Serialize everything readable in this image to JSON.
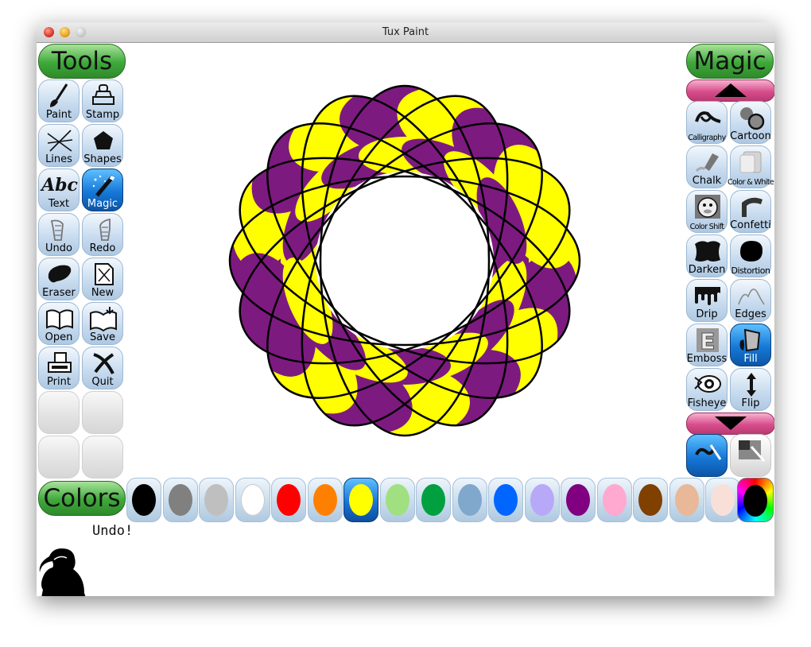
{
  "window": {
    "title": "Tux Paint"
  },
  "tools": {
    "header": "Tools",
    "items": [
      {
        "label": "Paint",
        "icon": "paintbrush-icon",
        "selected": false
      },
      {
        "label": "Stamp",
        "icon": "stamp-icon",
        "selected": false
      },
      {
        "label": "Lines",
        "icon": "lines-icon",
        "selected": false
      },
      {
        "label": "Shapes",
        "icon": "pentagon-icon",
        "selected": false
      },
      {
        "label": "Text",
        "icon": "text-abc-icon",
        "selected": false
      },
      {
        "label": "Magic",
        "icon": "magic-wand-icon",
        "selected": true
      },
      {
        "label": "Undo",
        "icon": "undo-hand-icon",
        "selected": false
      },
      {
        "label": "Redo",
        "icon": "redo-hand-icon",
        "selected": false
      },
      {
        "label": "Eraser",
        "icon": "eraser-icon",
        "selected": false
      },
      {
        "label": "New",
        "icon": "new-page-icon",
        "selected": false
      },
      {
        "label": "Open",
        "icon": "open-book-icon",
        "selected": false
      },
      {
        "label": "Save",
        "icon": "save-book-icon",
        "selected": false
      },
      {
        "label": "Print",
        "icon": "printer-icon",
        "selected": false
      },
      {
        "label": "Quit",
        "icon": "quit-x-icon",
        "selected": false
      }
    ]
  },
  "magic": {
    "header": "Magic",
    "items": [
      {
        "label": "Calligraphy",
        "icon": "calligraphy-icon",
        "selected": false
      },
      {
        "label": "Cartoon",
        "icon": "cartoon-icon",
        "selected": false
      },
      {
        "label": "Chalk",
        "icon": "chalk-icon",
        "selected": false
      },
      {
        "label": "Color & White",
        "icon": "color-white-icon",
        "selected": false
      },
      {
        "label": "Color Shift",
        "icon": "color-shift-icon",
        "selected": false
      },
      {
        "label": "Confetti",
        "icon": "confetti-icon",
        "selected": false
      },
      {
        "label": "Darken",
        "icon": "darken-icon",
        "selected": false
      },
      {
        "label": "Distortion",
        "icon": "distortion-icon",
        "selected": false
      },
      {
        "label": "Drip",
        "icon": "drip-icon",
        "selected": false
      },
      {
        "label": "Edges",
        "icon": "edges-icon",
        "selected": false
      },
      {
        "label": "Emboss",
        "icon": "emboss-icon",
        "selected": false
      },
      {
        "label": "Fill",
        "icon": "fill-bucket-icon",
        "selected": true
      },
      {
        "label": "Fisheye",
        "icon": "fisheye-icon",
        "selected": false
      },
      {
        "label": "Flip",
        "icon": "flip-icon",
        "selected": false
      }
    ],
    "modes": [
      {
        "icon": "paint-mode-icon",
        "selected": true
      },
      {
        "icon": "fullscreen-mode-icon",
        "selected": false
      }
    ]
  },
  "colors": {
    "header": "Colors",
    "palette": [
      {
        "color": "#000000",
        "selected": false
      },
      {
        "color": "#808080",
        "selected": false
      },
      {
        "color": "#bfbfbf",
        "selected": false
      },
      {
        "color": "#ffffff",
        "selected": false
      },
      {
        "color": "#ff0000",
        "selected": false
      },
      {
        "color": "#ff8000",
        "selected": false
      },
      {
        "color": "#ffff00",
        "selected": true
      },
      {
        "color": "#a0e080",
        "selected": false
      },
      {
        "color": "#00a040",
        "selected": false
      },
      {
        "color": "#80a8cc",
        "selected": false
      },
      {
        "color": "#0066ff",
        "selected": false
      },
      {
        "color": "#b8a8f8",
        "selected": false
      },
      {
        "color": "#800080",
        "selected": false
      },
      {
        "color": "#ffa8d0",
        "selected": false
      },
      {
        "color": "#804000",
        "selected": false
      },
      {
        "color": "#e8b898",
        "selected": false
      },
      {
        "color": "#f8e0d8",
        "selected": false
      }
    ]
  },
  "status": {
    "message": "Undo!"
  },
  "canvas_colors": {
    "yellow": "#ffff00",
    "purple": "#7d1a80"
  }
}
